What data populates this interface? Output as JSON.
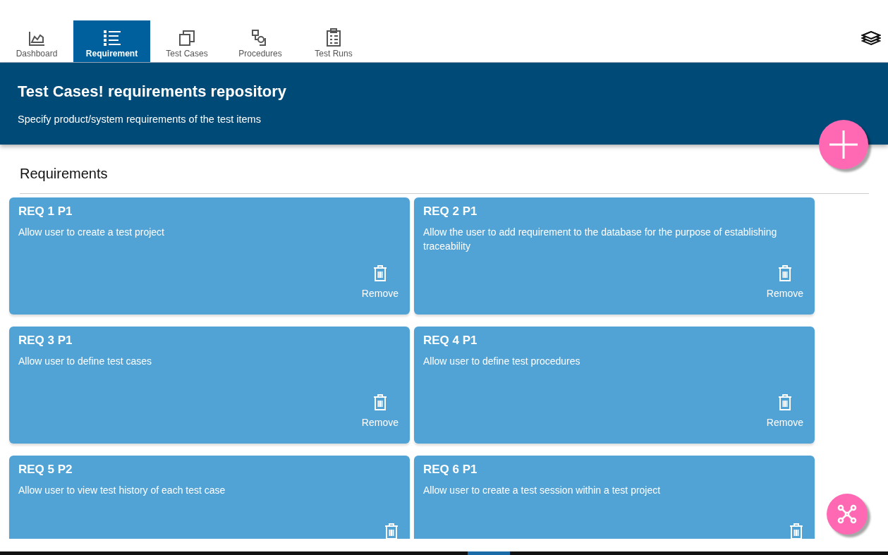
{
  "tabs": [
    {
      "label": "Dashboard",
      "kind": "chart",
      "selected": false
    },
    {
      "label": "Requirement",
      "kind": "list",
      "selected": true
    },
    {
      "label": "Test Cases",
      "kind": "copies",
      "selected": false
    },
    {
      "label": "Procedures",
      "kind": "flow",
      "selected": false
    },
    {
      "label": "Test Runs",
      "kind": "clipboard",
      "selected": false
    }
  ],
  "banner": {
    "title": "Test Cases! requirements repository",
    "subtitle": "Specify product/system requirements of the test items"
  },
  "section_title": "Requirements",
  "cards": [
    {
      "title": "REQ 1 P1",
      "description": "Allow user to create a test project",
      "remove_label": "Remove"
    },
    {
      "title": "REQ 2 P1",
      "description": "Allow the user to add requirement to the database for the purpose of establishing traceability",
      "remove_label": "Remove"
    },
    {
      "title": "REQ 3 P1",
      "description": "Allow user to define test cases",
      "remove_label": "Remove"
    },
    {
      "title": "REQ 4 P1",
      "description": "Allow user to define test procedures",
      "remove_label": "Remove"
    },
    {
      "title": "REQ 5 P2",
      "description": "Allow user to view test history of each test case"
    },
    {
      "title": "REQ 6 P1",
      "description": "Allow user to create a test session within a test project"
    }
  ]
}
